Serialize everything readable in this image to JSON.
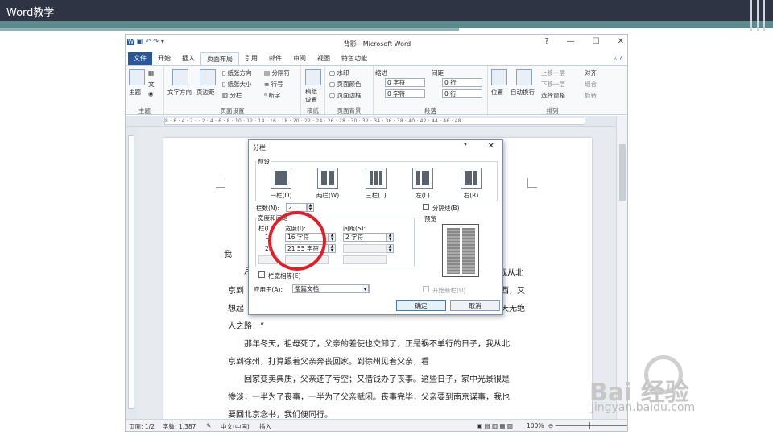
{
  "slide": {
    "title": "Word教学"
  },
  "window": {
    "title": "背影 - Microsoft Word",
    "controls": [
      "?",
      "—",
      "☐",
      "✕"
    ]
  },
  "tabs": [
    "文件",
    "开始",
    "插入",
    "页面布局",
    "引用",
    "邮件",
    "审阅",
    "视图",
    "特色功能"
  ],
  "ribbon": {
    "groups": {
      "theme": {
        "label": "主题",
        "btn": "主题"
      },
      "page_setup": {
        "label": "页面设置",
        "text_direction": "文字方向",
        "margins": "页边距",
        "orientation": "纸张方向",
        "size": "纸张大小",
        "columns": "分栏",
        "breaks": "分隔符",
        "line_numbers": "行号",
        "hyphenation": "断字"
      },
      "draft": {
        "label": "稿纸",
        "btn": "稿纸\n设置"
      },
      "page_background": {
        "label": "页面背景",
        "watermark": "水印",
        "page_color": "页面颜色",
        "page_borders": "页面边框"
      },
      "paragraph": {
        "label": "段落",
        "indent": "缩进",
        "spacing": "间距",
        "indent_left": "0 字符",
        "indent_right": "0 字符",
        "spacing_before": "0 行",
        "spacing_after": "0 行"
      },
      "arrange": {
        "label": "排列",
        "position": "位置",
        "wrap": "自动换行",
        "bring_forward": "上移一层",
        "send_backward": "下移一层",
        "selection_pane": "选择窗格",
        "align": "对齐",
        "group": "组合",
        "rotate": "旋转"
      }
    }
  },
  "ruler_text": "8 · 6 · 4 · 2 ·  · 2 · 4 · 6 · 8 · 10 · 12 · 14 · 16 · 18 · 20 · 22 · 24 · 26 · 28 · 30 · 32 · 34 · 36 · 38 · 40 · 42 · 44 · 46 · 48",
  "document": {
    "lines": [
      {
        "text": "我从北"
      },
      {
        "text": "京到",
        "right": "西，又"
      },
      {
        "text": "想起",
        "right": "天无绝"
      },
      {
        "text": "人之路！”"
      },
      {
        "text": "　　那年冬天，祖母死了，父亲的差使也交卸了，正是祸不单行的日子，我从北"
      },
      {
        "text": "京到徐州，打算跟着父亲奔丧回家。到徐州见着父亲，看"
      },
      {
        "text": "　　回家变卖典质，父亲还了亏空；又借钱办了丧事。这些日子，家中光景很是"
      },
      {
        "text": "惨淡，一半为了丧事，一半为了父亲赋闲。丧事完毕，父亲要到南京谋事，我也"
      },
      {
        "text": "要回北京念书，我们便同行。"
      }
    ],
    "left_frag_1": "月",
    "left_frag_2": "我"
  },
  "status": {
    "page": "页面: 1/2",
    "words": "字数: 1,387",
    "language": "中文(中国)",
    "mode": "插入",
    "zoom": "100%"
  },
  "dialog": {
    "title": "分栏",
    "help": "?",
    "close": "✕",
    "presets_label": "预设",
    "presets": [
      "一栏(O)",
      "两栏(W)",
      "三栏(T)",
      "左(L)",
      "右(R)"
    ],
    "num_columns_label": "栏数(N):",
    "num_columns": "2",
    "line_between_label": "分隔线(B)",
    "width_spacing_label": "宽度和间距",
    "col_header": "栏(C):",
    "width_header": "宽度(I):",
    "spacing_header": "间距(S):",
    "rows": [
      {
        "num": "1:",
        "width": "16 字符",
        "spacing": "2 字符"
      },
      {
        "num": "2:",
        "width": "21.55 字符",
        "spacing": ""
      }
    ],
    "preview_label": "预览",
    "equal_width_label": "栏宽相等(E)",
    "apply_to_label": "应用于(A):",
    "apply_to_value": "整篇文档",
    "new_column_label": "开始新栏(U)",
    "ok": "确定",
    "cancel": "取消"
  },
  "watermark": {
    "brand": "Bai  经验",
    "url": "jingyan.baidu.com"
  }
}
